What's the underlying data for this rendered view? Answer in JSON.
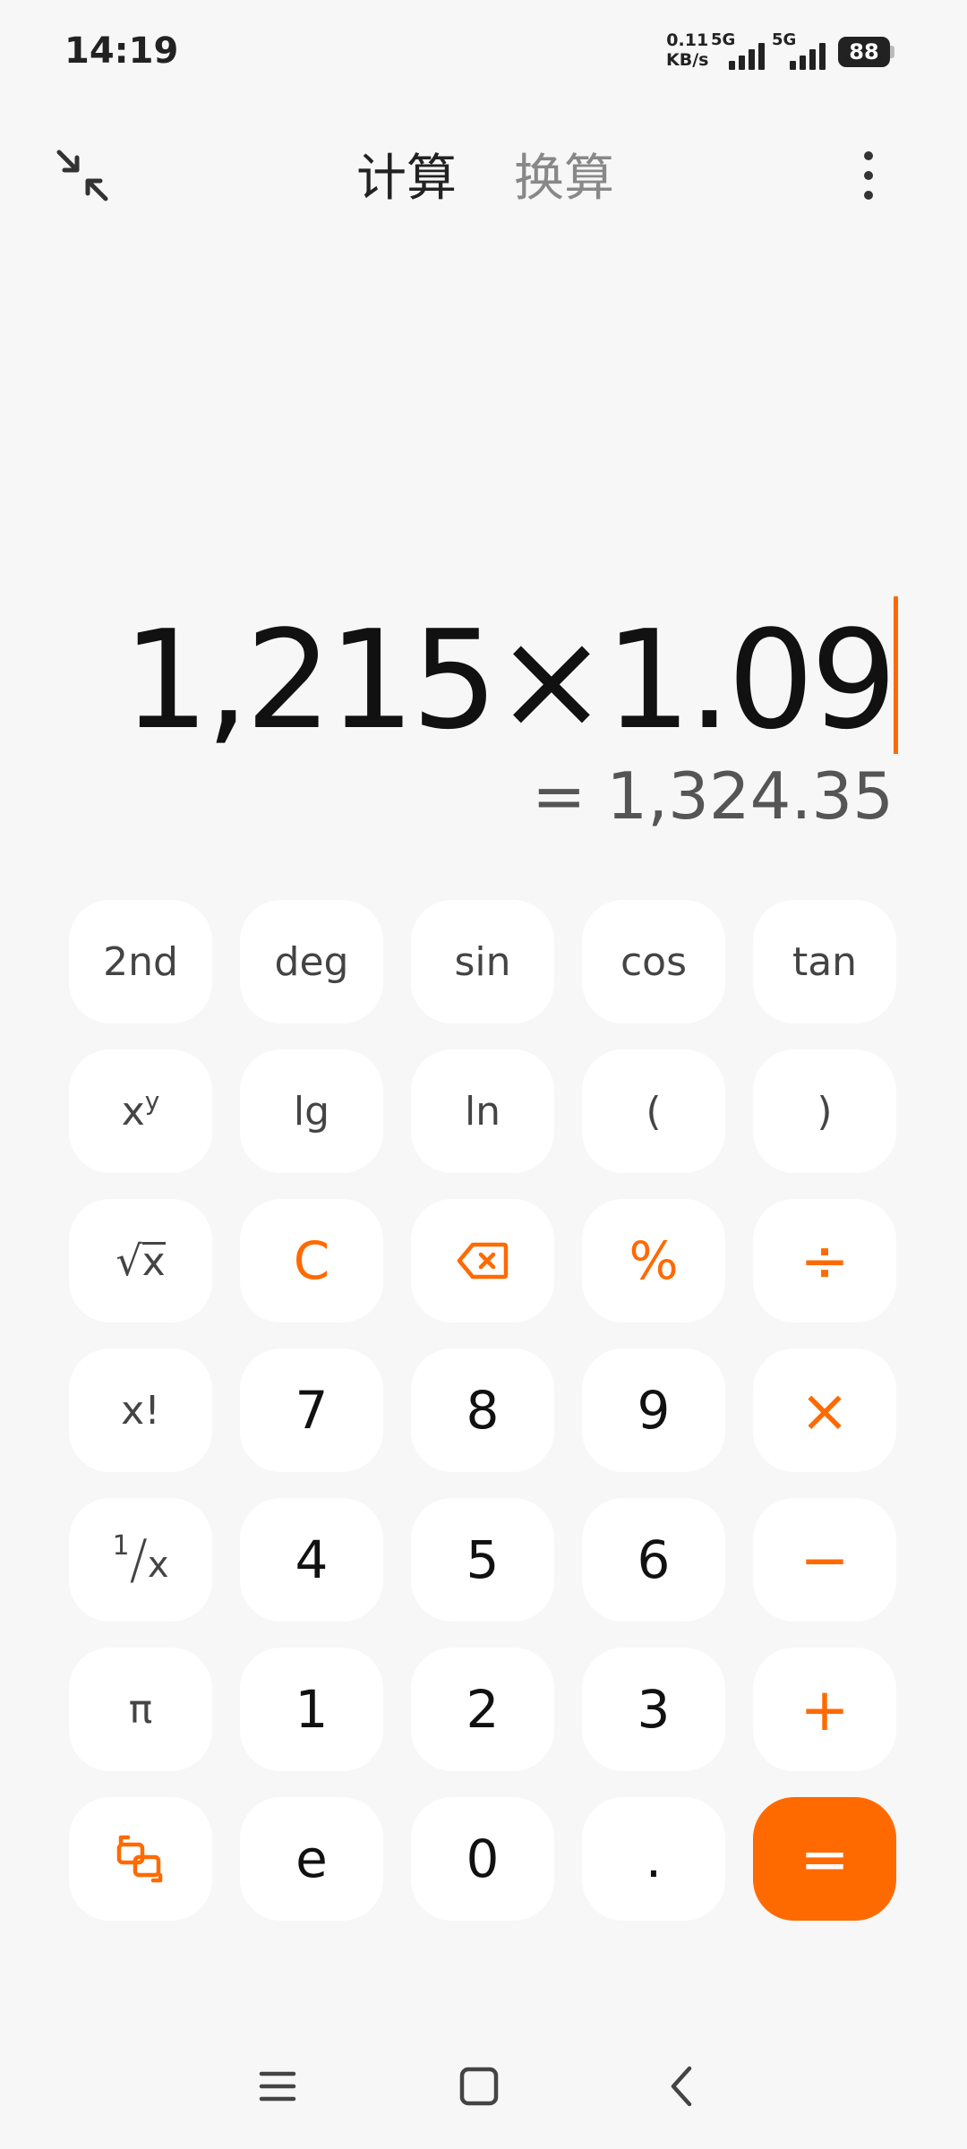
{
  "status_bar": {
    "time": "14:19",
    "net_speed_value": "0.11",
    "net_speed_unit": "KB/s",
    "sim1_tag": "5G",
    "sim2_tag": "5G",
    "battery": "88"
  },
  "header": {
    "tabs": [
      {
        "label": "计算",
        "active": true
      },
      {
        "label": "换算",
        "active": false
      }
    ]
  },
  "display": {
    "expression": "1,215×1.09",
    "result": "= 1,324.35"
  },
  "keypad": {
    "row1": [
      "2nd",
      "deg",
      "sin",
      "cos",
      "tan"
    ],
    "row2": {
      "power_base": "x",
      "power_exp": "y",
      "lg": "lg",
      "ln": "ln",
      "open_paren": "(",
      "close_paren": ")"
    },
    "row3": {
      "sqrt_label": "x",
      "clear": "C",
      "percent": "%",
      "divide": "÷"
    },
    "row4": {
      "factorial": "x!",
      "seven": "7",
      "eight": "8",
      "nine": "9",
      "multiply": "×"
    },
    "row5": {
      "recip_num": "1",
      "recip_den": "x",
      "four": "4",
      "five": "5",
      "six": "6",
      "minus": "−"
    },
    "row6": {
      "pi": "π",
      "one": "1",
      "two": "2",
      "three": "3",
      "plus": "+"
    },
    "row7": {
      "e": "e",
      "zero": "0",
      "dot": ".",
      "equals": "="
    }
  },
  "colors": {
    "accent": "#ff6a00",
    "background": "#f7f7f7",
    "key_background": "#ffffff"
  },
  "icons": {
    "collapse": "collapse-arrows-icon",
    "menu": "more-vertical-icon",
    "backspace": "backspace-icon",
    "rotate": "switch-layout-icon",
    "nav_menu": "menu-icon",
    "nav_home": "home-icon",
    "nav_back": "back-icon"
  }
}
